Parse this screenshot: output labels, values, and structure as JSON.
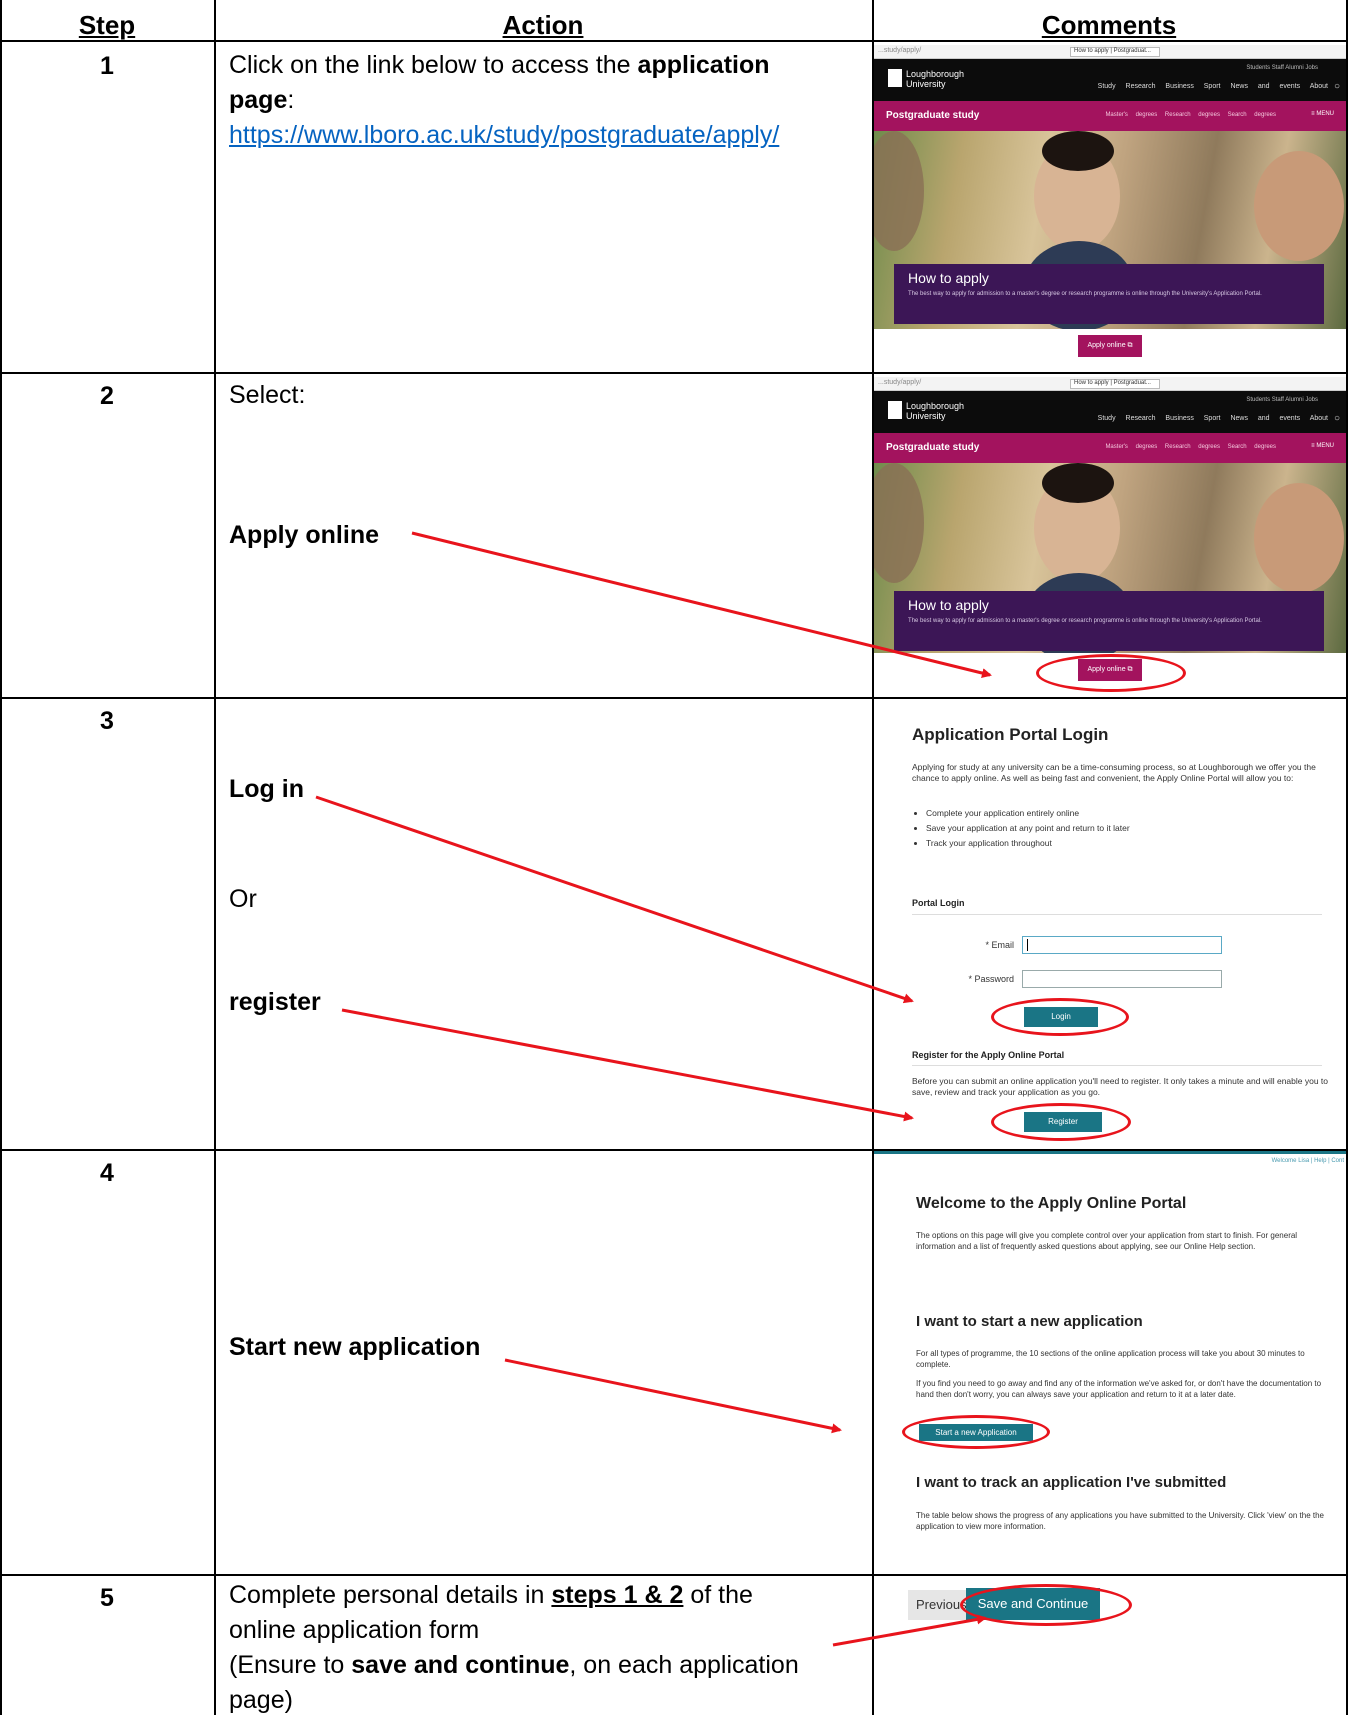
{
  "headers": {
    "step": "Step",
    "action": "Action",
    "comments": "Comments"
  },
  "steps": [
    {
      "num": "1",
      "action": {
        "line1": "Click on the link below to access the ",
        "bold": "application",
        "line2_bold": "page",
        "line2_rest": ":",
        "link": "https://www.lboro.ac.uk/study/postgraduate/apply/"
      }
    },
    {
      "num": "2",
      "action": {
        "text": "Select:",
        "bold": "Apply online"
      }
    },
    {
      "num": "3",
      "action": {
        "login": "Log in",
        "or": "Or",
        "register": "register"
      }
    },
    {
      "num": "4",
      "action": {
        "bold": "Start new application"
      }
    },
    {
      "num": "5",
      "action": {
        "pre": "Complete personal details in ",
        "bold_u": "steps 1 & 2",
        "post": " of the",
        "line2": "online application form",
        "line3_pre": "(Ensure to ",
        "line3_bold": "save and continue",
        "line3_post": ", on each application",
        "line4": "page)"
      }
    }
  ],
  "website": {
    "url": "...study/apply/",
    "tab": "How to apply | Postgraduat...",
    "logo_line1": "Loughborough",
    "logo_line2": "University",
    "toplinks": "Students   Staff   Alumni   Jobs",
    "nav": "Study Research Business Sport News and events About",
    "section": "Postgraduate study",
    "subnav": "Master's degrees  Research degrees  Search degrees",
    "menu": "≡ MENU",
    "hero_title": "How to apply",
    "hero_text": "The best way to apply for admission to a master's degree or research programme is online through the University's Application Portal.",
    "apply_button": "Apply online ⧉"
  },
  "login_page": {
    "title": "Application Portal Login",
    "intro": "Applying for study at any university can be a time-consuming process, so at Loughborough we offer you the chance to apply online. As well as being fast and convenient, the Apply Online Portal will allow you to:",
    "bullets": [
      "Complete your application entirely online",
      "Save your application at any point and return to it later",
      "Track your application throughout"
    ],
    "portal_login": "Portal Login",
    "email_label": "* Email",
    "password_label": "* Password",
    "login_button": "Login",
    "register_heading": "Register for the Apply Online Portal",
    "register_text": "Before you can submit an online application you'll need to register. It only takes a minute and will enable you to save, review and track your application as you go.",
    "register_button": "Register"
  },
  "welcome_page": {
    "topline": "Welcome Lisa | Help | Cont",
    "title": "Welcome to the Apply Online Portal",
    "intro": "The options on this page will give you complete control over your application from start to finish. For general information and a list of frequently asked questions about applying, see our Online Help section.",
    "new_heading": "I want to start a new application",
    "new_p1": "For all types of programme, the 10 sections of the online application process will take you about 30 minutes to complete.",
    "new_p2": "If you find you need to go away and find any of the information we've asked for, or don't have the documentation to hand then don't worry, you can always save your application and return to it at a later date.",
    "start_button": "Start a new Application",
    "track_heading": "I want to track an application I've submitted",
    "track_p": "The table below shows the progress of any applications you have submitted to the University. Click 'view' on the the application to view more information."
  },
  "form_buttons": {
    "previous": "Previous",
    "save": "Save and Continue"
  },
  "colors": {
    "annotation": "#e8141c",
    "teal": "#1a7585",
    "magenta": "#a3135e",
    "purple": "#3c1656",
    "link": "#0563c1"
  }
}
